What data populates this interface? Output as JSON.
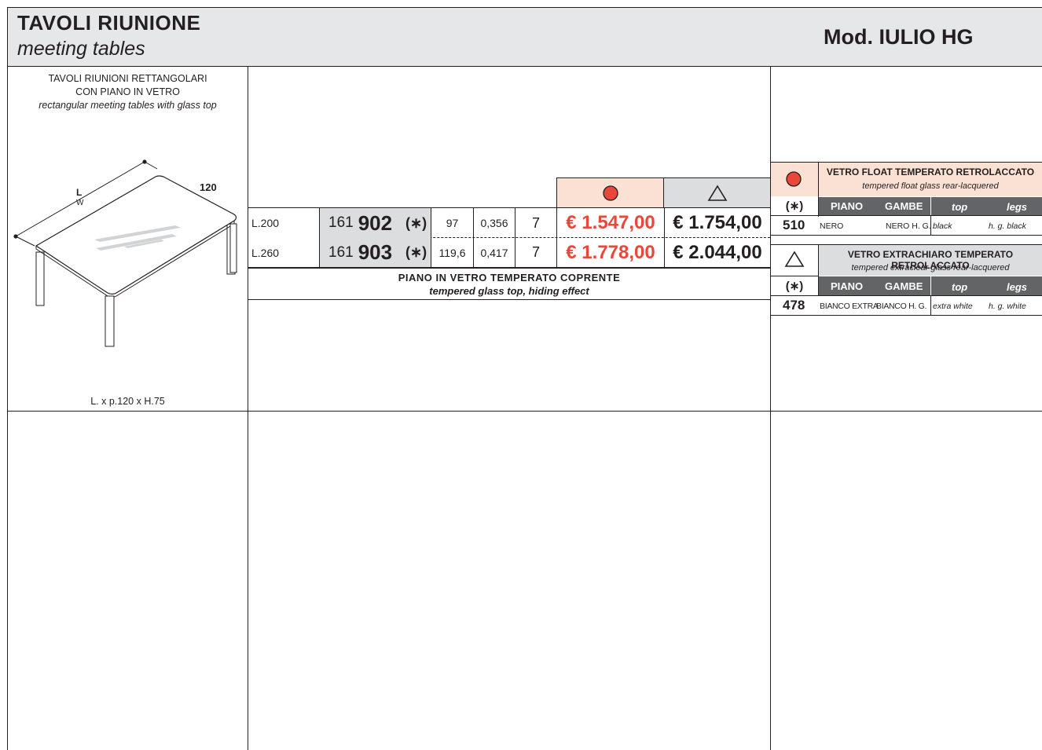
{
  "header": {
    "title": "TAVOLI RIUNIONE",
    "subtitle": "meeting tables",
    "model": "Mod. IULIO HG"
  },
  "product": {
    "name_line1": "TAVOLI RIUNIONI RETTANGOLARI",
    "name_line2": "CON PIANO IN VETRO",
    "name_en": "rectangular meeting tables with glass top",
    "dim_L": "L",
    "dim_W": "W",
    "dim_depth": "120",
    "dimensions": "L. x p.120 x H.75"
  },
  "price_table": {
    "rows": [
      {
        "size": "L.200",
        "code_prefix": "161",
        "code": "902",
        "asterisk": "(∗)",
        "weight": "97",
        "volume": "0,356",
        "qty": "7",
        "price_circle": "€ 1.547,00",
        "price_triangle": "€ 1.754,00"
      },
      {
        "size": "L.260",
        "code_prefix": "161",
        "code": "903",
        "asterisk": "(∗)",
        "weight": "119,6",
        "volume": "0,417",
        "qty": "7",
        "price_circle": "€ 1.778,00",
        "price_triangle": "€ 2.044,00"
      }
    ],
    "note_it": "PIANO IN VETRO TEMPERATO COPRENTE",
    "note_en": "tempered glass top, hiding effect"
  },
  "finishes": {
    "circle": {
      "title": "VETRO FLOAT TEMPERATO RETROLACCATO",
      "subtitle": "tempered float glass rear-lacquered",
      "asterisk": "(∗)",
      "col_piano": "PIANO",
      "col_gambe": "GAMBE",
      "col_top": "top",
      "col_legs": "legs",
      "code": "510",
      "piano": "NERO",
      "gambe": "NERO H. G.",
      "top": "black",
      "legs": "h. g. black"
    },
    "triangle": {
      "title": "VETRO EXTRACHIARO TEMPERATO RETROLACCATO",
      "subtitle": "tempered extraclear glass rear-lacquered",
      "asterisk": "(∗)",
      "col_piano": "PIANO",
      "col_gambe": "GAMBE",
      "col_top": "top",
      "col_legs": "legs",
      "code": "478",
      "piano": "BIANCO EXTRA",
      "gambe": "BIANCO H. G.",
      "top": "extra white",
      "legs": "h. g. white"
    }
  },
  "colors": {
    "price_accent": "#e8473a",
    "circle_fill": "#e8473a",
    "header_bg": "#e6e7e8",
    "pink_cell": "#fbe0d4",
    "dark_bar": "#636466"
  },
  "icons": {
    "finish_a": "red-circle-icon",
    "finish_b": "triangle-icon"
  }
}
